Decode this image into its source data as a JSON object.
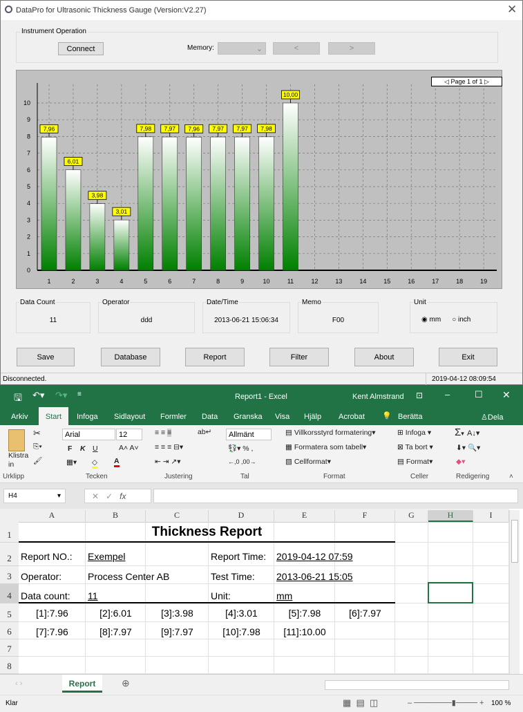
{
  "app": {
    "title": "DataPro for Ultrasonic Thickness Gauge (Version:V2.27)",
    "instrument": {
      "label": "Instrument Operation",
      "connect": "Connect",
      "memory_label": "Memory:",
      "memory_value": "",
      "prev": "<",
      "next": ">"
    },
    "chart_pager": "Page 1 of 1",
    "info": {
      "data_count_label": "Data Count",
      "data_count": "11",
      "operator_label": "Operator",
      "operator": "ddd",
      "datetime_label": "Date/Time",
      "datetime": "2013-06-21 15:06:34",
      "memo_label": "Memo",
      "memo": "F00",
      "unit_label": "Unit",
      "unit_mm": "mm",
      "unit_inch": "inch",
      "unit_selected": "mm"
    },
    "buttons": [
      "Save",
      "Database",
      "Report",
      "Filter",
      "About",
      "Exit"
    ],
    "status": "Disconnected.",
    "clock": "2019-04-12 08:09:54"
  },
  "chart_data": {
    "type": "bar",
    "categories": [
      "1",
      "2",
      "3",
      "4",
      "5",
      "6",
      "7",
      "8",
      "9",
      "10",
      "11",
      "12",
      "13",
      "14",
      "15",
      "16",
      "17",
      "18",
      "19"
    ],
    "values": [
      7.96,
      6.01,
      3.98,
      3.01,
      7.98,
      7.97,
      7.96,
      7.97,
      7.97,
      7.98,
      10.0
    ],
    "labels": [
      "7,96",
      "6,01",
      "3,98",
      "3,01",
      "7,98",
      "7,97",
      "7,96",
      "7,97",
      "7,97",
      "7,98",
      "10,00"
    ],
    "yticks": [
      "0",
      "1",
      "2",
      "3",
      "4",
      "5",
      "6",
      "7",
      "8",
      "9",
      "10"
    ],
    "ylim": [
      0,
      10.8
    ],
    "grid": true,
    "bar_color": "#008000",
    "label_bg": "#ffff00"
  },
  "excel": {
    "title": "Report1  -  Excel",
    "user": "Kent Almstrand",
    "tabs": [
      "Arkiv",
      "Start",
      "Infoga",
      "Sidlayout",
      "Formler",
      "Data",
      "Granska",
      "Visa",
      "Hjälp",
      "Acrobat",
      "Berätta",
      "Dela"
    ],
    "ribbon": {
      "paste": "Klistra in",
      "font": "Arial",
      "size": "12",
      "bold": "F",
      "italic": "K",
      "underline": "U",
      "number_format": "Allmänt",
      "cond": "Villkorsstyrd formatering",
      "table": "Formatera som tabell",
      "cellstyle": "Cellformat",
      "insert": "Infoga",
      "delete": "Ta bort",
      "format": "Format",
      "groups": [
        "Urklipp",
        "Tecken",
        "Justering",
        "Tal",
        "Format",
        "Celler",
        "Redigering"
      ]
    },
    "namebox": "H4",
    "formula": "",
    "columns": [
      "A",
      "B",
      "C",
      "D",
      "E",
      "F",
      "G",
      "H",
      "I"
    ],
    "rows": [
      "1",
      "2",
      "3",
      "4",
      "5",
      "6",
      "7",
      "8"
    ],
    "report_title": "Thickness Report",
    "fields": {
      "report_no_label": "Report NO.:",
      "report_no": "Exempel",
      "report_time_label": "Report Time:",
      "report_time": "2019-04-12 07:59",
      "operator_label": "Operator:",
      "operator": "Process Center AB",
      "test_time_label": "Test Time:",
      "test_time": "2013-06-21 15:05",
      "count_label": "Data count:",
      "count": "11",
      "unit_label": "Unit:",
      "unit": "mm"
    },
    "readings": [
      [
        "[1]:7.96",
        "[2]:6.01",
        "[3]:3.98",
        "[4]:3.01",
        "[5]:7.98",
        "[6]:7.97"
      ],
      [
        "[7]:7.96",
        "[8]:7.97",
        "[9]:7.97",
        "[10]:7.98",
        "[11]:10.00"
      ]
    ],
    "sheet_tab": "Report",
    "status": "Klar",
    "zoom": "100 %",
    "accent": "#217346"
  }
}
